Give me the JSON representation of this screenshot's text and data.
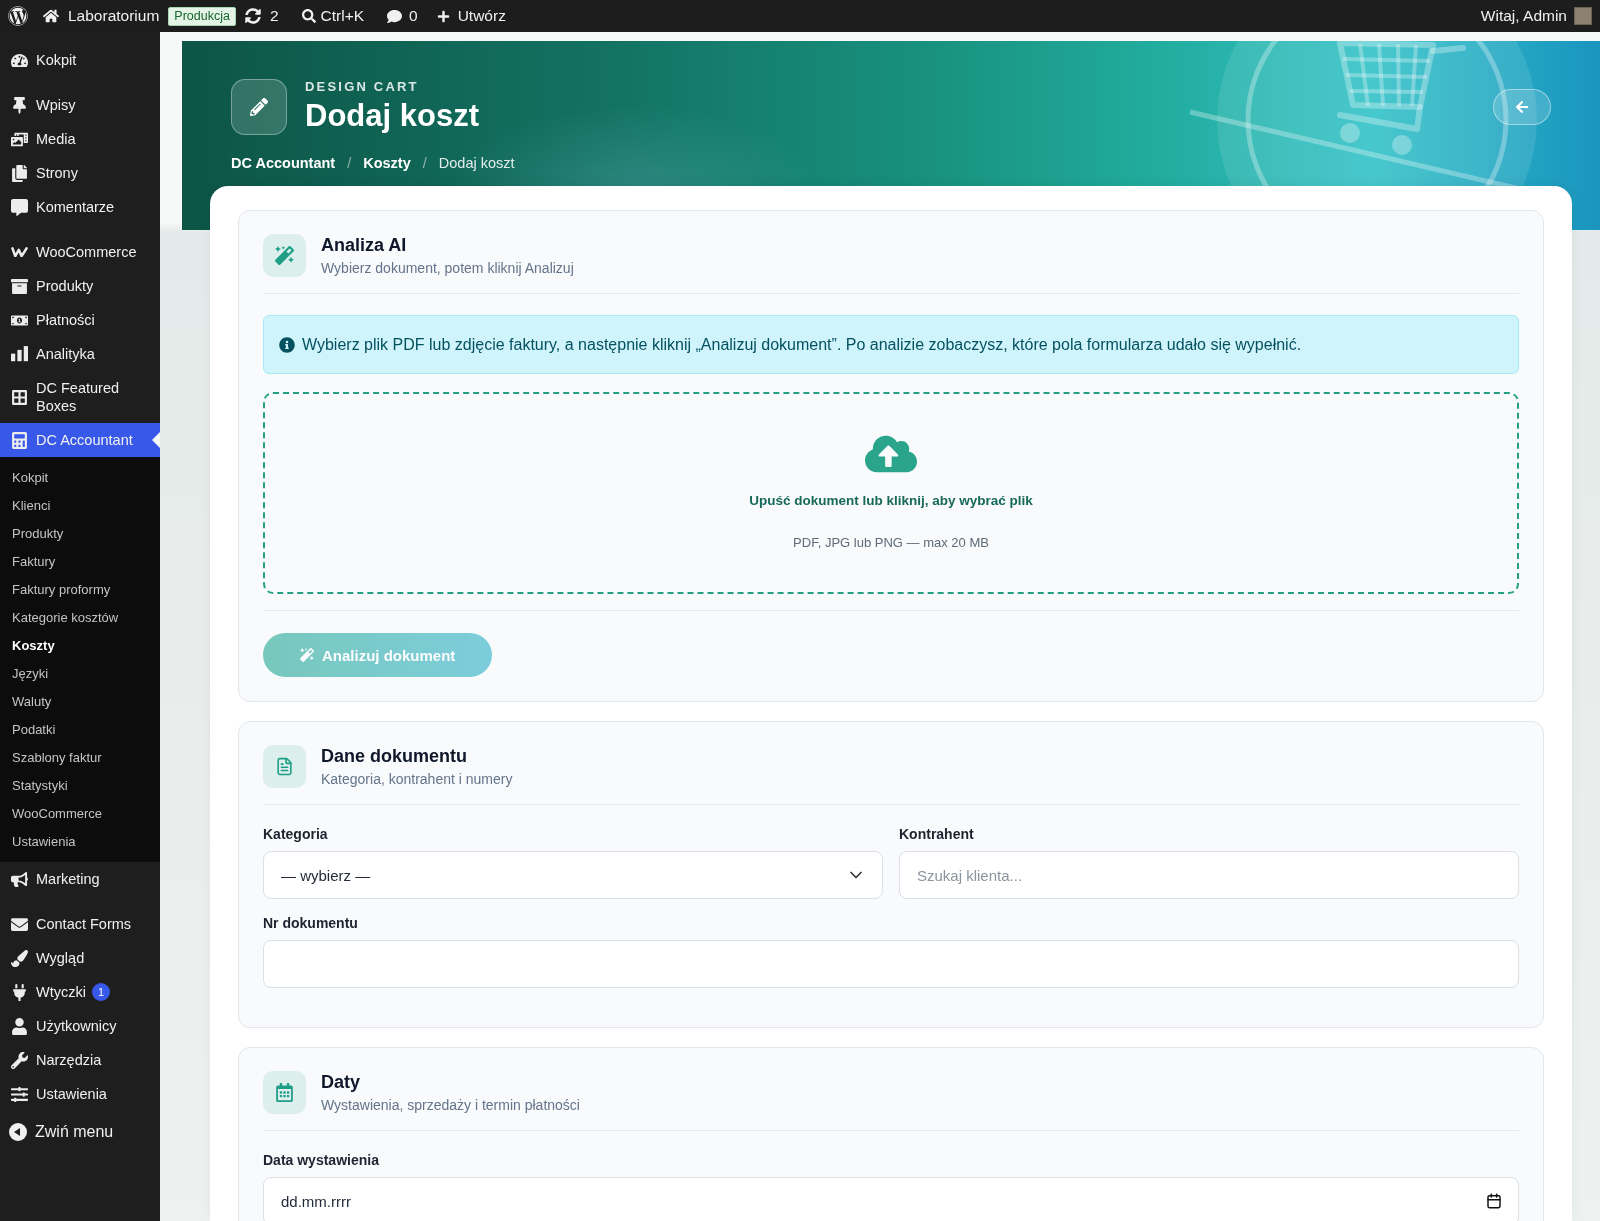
{
  "admin_bar": {
    "site": "Laboratorium",
    "environment": "Produkcja",
    "updates": "2",
    "search_shortcut": "Ctrl+K",
    "comments": "0",
    "new": "Utwórz",
    "greeting": "Witaj, Admin"
  },
  "sidebar": {
    "sections": [
      {
        "items": [
          {
            "label": "Kokpit",
            "selected": false
          }
        ]
      },
      {
        "items": [
          {
            "label": "Wpisy",
            "selected": false
          },
          {
            "label": "Media",
            "selected": false
          },
          {
            "label": "Strony",
            "selected": false
          },
          {
            "label": "Komentarze",
            "selected": false
          }
        ]
      },
      {
        "items": [
          {
            "label": "WooCommerce",
            "selected": false
          },
          {
            "label": "Produkty",
            "selected": false
          },
          {
            "label": "Płatności",
            "selected": false
          },
          {
            "label": "Analityka",
            "selected": false
          },
          {
            "label": "DC Featured Boxes",
            "selected": false
          },
          {
            "label": "DC Accountant",
            "selected": true,
            "children": [
              {
                "label": "Kokpit",
                "selected": false
              },
              {
                "label": "Klienci",
                "selected": false
              },
              {
                "label": "Produkty",
                "selected": false
              },
              {
                "label": "Faktury",
                "selected": false
              },
              {
                "label": "Faktury proformy",
                "selected": false
              },
              {
                "label": "Kategorie kosztów",
                "selected": false
              },
              {
                "label": "Koszty",
                "selected": true
              },
              {
                "label": "Języki",
                "selected": false
              },
              {
                "label": "Waluty",
                "selected": false
              },
              {
                "label": "Podatki",
                "selected": false
              },
              {
                "label": "Szablony faktur",
                "selected": false
              },
              {
                "label": "Statystyki",
                "selected": false
              },
              {
                "label": "WooCommerce",
                "selected": false
              },
              {
                "label": "Ustawienia",
                "selected": false
              }
            ]
          },
          {
            "label": "Marketing",
            "selected": false
          }
        ]
      },
      {
        "items": [
          {
            "label": "Contact Forms",
            "selected": false
          },
          {
            "label": "Wygląd",
            "selected": false
          },
          {
            "label": "Wtyczki",
            "selected": false,
            "badge": "1"
          },
          {
            "label": "Użytkownicy",
            "selected": false
          },
          {
            "label": "Narzędzia",
            "selected": false
          },
          {
            "label": "Ustawienia",
            "selected": false
          }
        ]
      }
    ],
    "collapse": "Zwiń menu"
  },
  "header": {
    "eyebrow": "DESIGN CART",
    "title": "Dodaj koszt",
    "breadcrumb": [
      {
        "kind": "link",
        "label": "DC Accountant"
      },
      {
        "kind": "separator",
        "label": "/"
      },
      {
        "kind": "link",
        "label": "Koszty"
      },
      {
        "kind": "separator",
        "label": "/"
      },
      {
        "kind": "current",
        "label": "Dodaj koszt"
      }
    ]
  },
  "cards": [
    {
      "kind": "ai",
      "title": "Analiza AI",
      "subtitle": "Wybierz dokument, potem kliknij Analizuj",
      "alert": "Wybierz plik PDF lub zdjęcie faktury, a następnie kliknij „Analizuj dokument”. Po analizie zobaczysz, które pola formularza udało się wypełnić.",
      "dropzone": {
        "title": "Upuść dokument lub kliknij, aby wybrać plik",
        "hint": "PDF, JPG lub PNG — max 20 MB"
      },
      "button": {
        "label": "Analizuj dokument",
        "disabled": true
      }
    },
    {
      "kind": "form",
      "title": "Dane dokumentu",
      "subtitle": "Kategoria, kontrahent i numery",
      "rows": [
        [
          {
            "kind": "select",
            "label": "Kategoria",
            "value": "— wybierz —"
          },
          {
            "kind": "search",
            "label": "Kontrahent",
            "placeholder": "Szukaj klienta..."
          }
        ],
        [
          {
            "kind": "text",
            "label": "Nr dokumentu"
          }
        ]
      ]
    },
    {
      "kind": "form",
      "title": "Daty",
      "subtitle": "Wystawienia, sprzedaży i termin płatności",
      "rows": [
        [
          {
            "kind": "date",
            "label": "Data wystawienia",
            "placeholder": "dd.mm.rrrr"
          }
        ]
      ]
    }
  ]
}
